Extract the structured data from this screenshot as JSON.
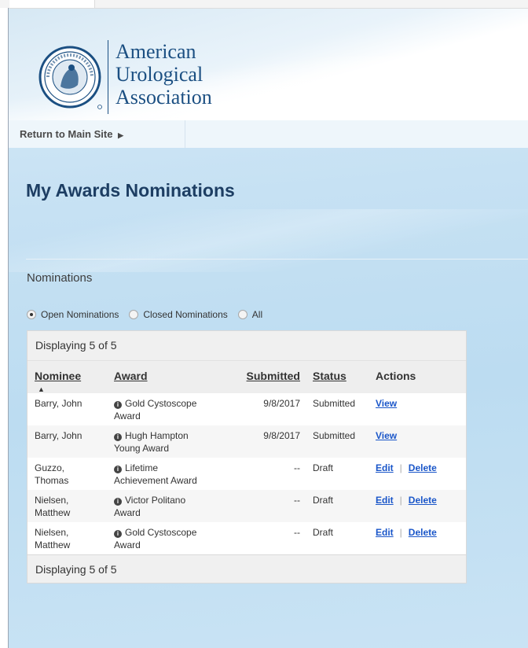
{
  "logo": {
    "line1": "American",
    "line2": "Urological",
    "line3": "Association"
  },
  "nav": {
    "return_label": "Return to Main Site",
    "return_arrow": "▶"
  },
  "page": {
    "title": "My Awards Nominations",
    "section_label": "Nominations"
  },
  "filters": {
    "open": "Open Nominations",
    "closed": "Closed Nominations",
    "all": "All",
    "selected": "open"
  },
  "grid": {
    "summary_top": "Displaying 5 of 5",
    "summary_bottom": "Displaying 5 of 5",
    "columns": {
      "nominee": "Nominee",
      "award": "Award",
      "submitted": "Submitted",
      "status": "Status",
      "actions": "Actions"
    },
    "sort_arrow": "▲",
    "info_glyph": "i",
    "separator": "|",
    "rows": [
      {
        "nominee_line1": "Barry, John",
        "nominee_line2": "",
        "award_line1": "Gold Cystoscope",
        "award_line2": "Award",
        "submitted": "9/8/2017",
        "status": "Submitted",
        "action1": "View",
        "action2": ""
      },
      {
        "nominee_line1": "Barry, John",
        "nominee_line2": "",
        "award_line1": "Hugh Hampton",
        "award_line2": "Young Award",
        "submitted": "9/8/2017",
        "status": "Submitted",
        "action1": "View",
        "action2": ""
      },
      {
        "nominee_line1": "Guzzo,",
        "nominee_line2": "Thomas",
        "award_line1": "Lifetime",
        "award_line2": "Achievement Award",
        "submitted": "--",
        "status": "Draft",
        "action1": "Edit",
        "action2": "Delete"
      },
      {
        "nominee_line1": "Nielsen,",
        "nominee_line2": "Matthew",
        "award_line1": "Victor Politano",
        "award_line2": "Award",
        "submitted": "--",
        "status": "Draft",
        "action1": "Edit",
        "action2": "Delete"
      },
      {
        "nominee_line1": "Nielsen,",
        "nominee_line2": "Matthew",
        "award_line1": "Gold Cystoscope",
        "award_line2": "Award",
        "submitted": "--",
        "status": "Draft",
        "action1": "Edit",
        "action2": "Delete"
      }
    ]
  },
  "colors": {
    "brand": "#1b4f82",
    "title": "#1d3e63",
    "link": "#1a56c9"
  }
}
